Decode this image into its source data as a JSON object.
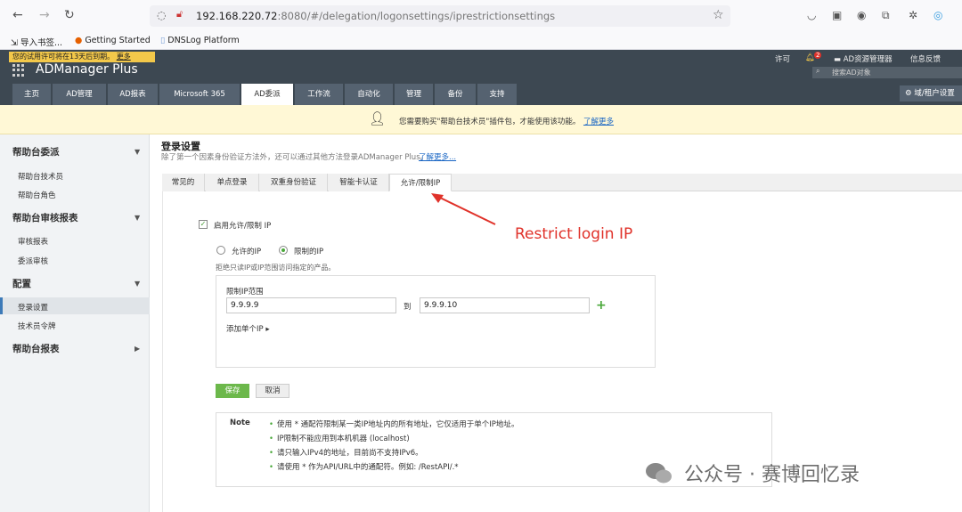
{
  "browser": {
    "url_host": "192.168.220.72",
    "url_rest": ":8080/#/delegation/logonsettings/iprestrictionsettings",
    "bookmarks": [
      "导入书签...",
      "Getting Started",
      "DNSLog Platform"
    ]
  },
  "header": {
    "trial_text": "您的试用许可将在13天后到期。",
    "trial_link": "更多",
    "logo": "ADManager Plus",
    "links": {
      "license": "许可",
      "notification_count": "2",
      "ad_explorer": "AD资源管理器",
      "feedback": "信息反馈"
    },
    "search_placeholder": "搜索AD对象",
    "domain_button": "域/租户设置",
    "tabs": [
      "主页",
      "AD管理",
      "AD报表",
      "Microsoft 365",
      "AD委派",
      "工作流",
      "自动化",
      "管理",
      "备份",
      "支持"
    ]
  },
  "banner": {
    "text": "您需要购买\"帮助台技术员\"插件包，才能使用该功能。",
    "link": "了解更多"
  },
  "sidebar": {
    "sections": [
      {
        "title": "帮助台委派",
        "items": [
          "帮助台技术员",
          "帮助台角色"
        ]
      },
      {
        "title": "帮助台审核报表",
        "items": [
          "审核报表",
          "委派审核"
        ]
      },
      {
        "title": "配置",
        "items": [
          "登录设置",
          "技术员令牌"
        ]
      },
      {
        "title": "帮助台报表",
        "items": []
      }
    ]
  },
  "main": {
    "title": "登录设置",
    "description": "除了第一个因素身份验证方法外，还可以通过其他方法登录ADManager Plus。",
    "description_link": "了解更多...",
    "subtabs": [
      "常见的",
      "单点登录",
      "双重身份验证",
      "智能卡认证",
      "允许/限制IP"
    ],
    "enable_label": "启用允许/限制 IP",
    "radio_allow": "允许的IP",
    "radio_restrict": "限制的IP",
    "restrict_desc": "拒绝只读IP或IP范围访问指定的产品。",
    "range_label": "限制IP范围",
    "ip_from": "9.9.9.9",
    "to_label": "到",
    "ip_to": "9.9.9.10",
    "add_single": "添加单个IP ▸",
    "save": "保存",
    "cancel": "取消"
  },
  "note": {
    "title": "Note",
    "lines": [
      "使用 * 通配符限制某一类IP地址内的所有地址，它仅适用于单个IP地址。",
      "IP限制不能应用到本机机器 (localhost)",
      "请只输入IPv4的地址，目前尚不支持IPv6。",
      "请使用 * 作为API/URL中的通配符。例如: /RestAPI/.*"
    ]
  },
  "annotation": {
    "text": "Restrict login IP",
    "color": "#e0322a"
  },
  "watermark": "公众号 · 赛博回忆录"
}
